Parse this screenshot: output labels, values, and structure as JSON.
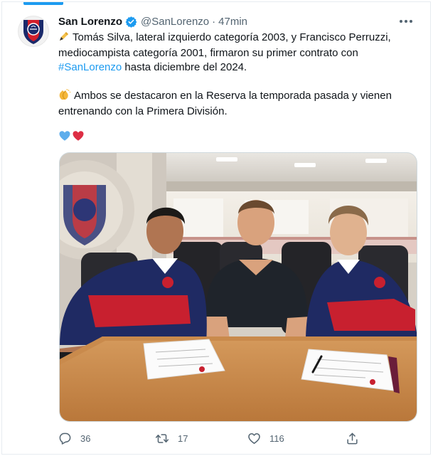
{
  "tweet": {
    "author": {
      "display_name": "San Lorenzo",
      "handle": "@SanLorenzo",
      "verified": true,
      "avatar": "san-lorenzo-crest"
    },
    "separator": "·",
    "time": "47min",
    "text": {
      "p1_emoji": "writing-hand-emoji",
      "p1": "Tomás Silva, lateral izquierdo categoría 2003, y Francisco Perruzzi, mediocampista categoría 2001, firmaron su primer contrato con",
      "hashtag": "#SanLorenzo",
      "p1_end": " hasta diciembre del 2024.",
      "p2_emoji": "clapping-hands-emoji",
      "p2": "Ambos se destacaron en la Reserva la temporada pasada y vienen entrenando con la Primera División.",
      "p3_emojis": [
        "blue-heart-emoji",
        "red-heart-emoji"
      ]
    },
    "media": {
      "description_icon": "photo-signing-contract"
    },
    "actions": {
      "reply_count": "36",
      "retweet_count": "17",
      "like_count": "116"
    }
  },
  "colors": {
    "accent": "#1d9bf0",
    "text": "#0f1419",
    "muted": "#536471",
    "club_blue": "#1b2a6b",
    "club_red": "#d21f2b"
  }
}
